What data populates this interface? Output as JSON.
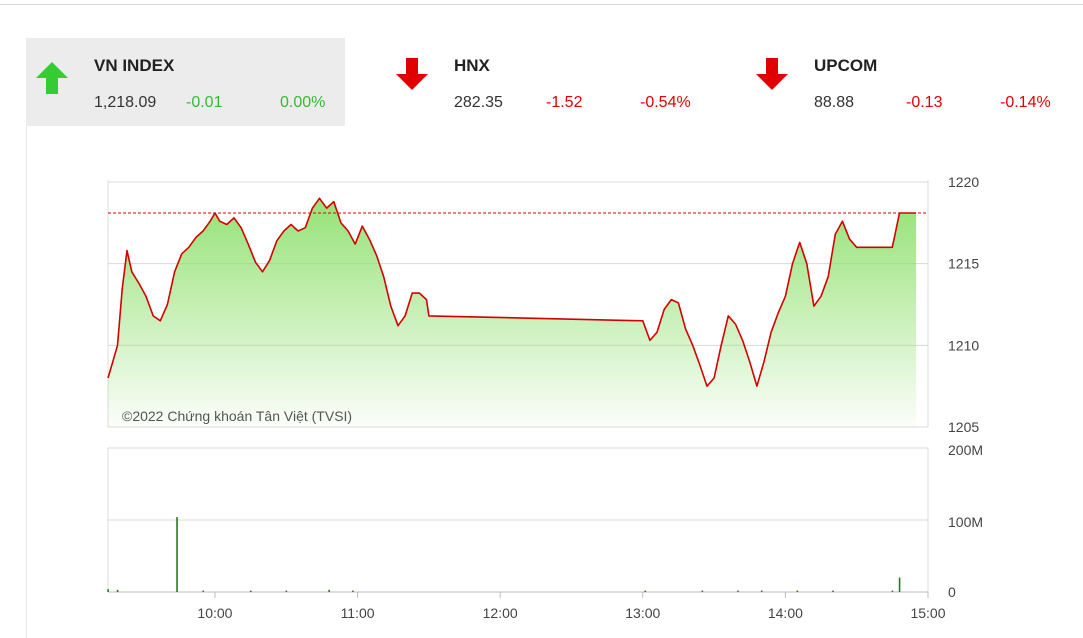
{
  "tickers": [
    {
      "name": "VN INDEX",
      "value": "1,218.09",
      "change": "-0.01",
      "pct": "0.00%",
      "direction": "up",
      "active": true
    },
    {
      "name": "HNX",
      "value": "282.35",
      "change": "-1.52",
      "pct": "-0.54%",
      "direction": "down",
      "active": false
    },
    {
      "name": "UPCOM",
      "value": "88.88",
      "change": "-0.13",
      "pct": "-0.14%",
      "direction": "down",
      "active": false
    }
  ],
  "colors": {
    "up": "#33cc33",
    "down": "#e00000",
    "line": "#d40000",
    "fill": "#8fe06e",
    "grid": "#d8d8d8"
  },
  "copyright": "©2022 Chứng khoán Tân Việt (TVSI)",
  "chart_data": [
    {
      "type": "area",
      "name": "price",
      "y_ticks": [
        "1220",
        "1215",
        "1210",
        "1205"
      ],
      "ylim": [
        1205,
        1220
      ],
      "reference": 1218.1,
      "x_ticks": [
        "10:00",
        "11:00",
        "12:00",
        "13:00",
        "14:00",
        "15:00"
      ],
      "xlim": [
        "09:15",
        "15:00"
      ],
      "points": [
        [
          "09:15",
          1208.0
        ],
        [
          "09:17",
          1209.0
        ],
        [
          "09:19",
          1210.0
        ],
        [
          "09:21",
          1213.5
        ],
        [
          "09:23",
          1215.8
        ],
        [
          "09:25",
          1214.5
        ],
        [
          "09:28",
          1213.8
        ],
        [
          "09:31",
          1213.0
        ],
        [
          "09:34",
          1211.8
        ],
        [
          "09:37",
          1211.5
        ],
        [
          "09:40",
          1212.5
        ],
        [
          "09:43",
          1214.5
        ],
        [
          "09:46",
          1215.6
        ],
        [
          "09:49",
          1216.0
        ],
        [
          "09:52",
          1216.6
        ],
        [
          "09:55",
          1217.0
        ],
        [
          "09:58",
          1217.6
        ],
        [
          "10:00",
          1218.1
        ],
        [
          "10:02",
          1217.6
        ],
        [
          "10:05",
          1217.4
        ],
        [
          "10:08",
          1217.8
        ],
        [
          "10:11",
          1217.2
        ],
        [
          "10:14",
          1216.2
        ],
        [
          "10:17",
          1215.1
        ],
        [
          "10:20",
          1214.5
        ],
        [
          "10:23",
          1215.2
        ],
        [
          "10:26",
          1216.4
        ],
        [
          "10:29",
          1217.0
        ],
        [
          "10:32",
          1217.4
        ],
        [
          "10:35",
          1217.0
        ],
        [
          "10:38",
          1217.2
        ],
        [
          "10:41",
          1218.4
        ],
        [
          "10:44",
          1219.0
        ],
        [
          "10:47",
          1218.4
        ],
        [
          "10:50",
          1218.8
        ],
        [
          "10:53",
          1217.5
        ],
        [
          "10:56",
          1217.0
        ],
        [
          "10:59",
          1216.2
        ],
        [
          "11:02",
          1217.3
        ],
        [
          "11:05",
          1216.5
        ],
        [
          "11:08",
          1215.5
        ],
        [
          "11:11",
          1214.2
        ],
        [
          "11:14",
          1212.4
        ],
        [
          "11:17",
          1211.2
        ],
        [
          "11:20",
          1211.8
        ],
        [
          "11:23",
          1213.2
        ],
        [
          "11:26",
          1213.2
        ],
        [
          "11:29",
          1212.8
        ],
        [
          "11:30",
          1211.8
        ],
        [
          "13:00",
          1211.5
        ],
        [
          "13:03",
          1210.3
        ],
        [
          "13:06",
          1210.8
        ],
        [
          "13:09",
          1212.2
        ],
        [
          "13:12",
          1212.8
        ],
        [
          "13:15",
          1212.6
        ],
        [
          "13:18",
          1211.0
        ],
        [
          "13:21",
          1210.0
        ],
        [
          "13:24",
          1208.8
        ],
        [
          "13:27",
          1207.5
        ],
        [
          "13:30",
          1208.0
        ],
        [
          "13:33",
          1210.0
        ],
        [
          "13:36",
          1211.8
        ],
        [
          "13:39",
          1211.3
        ],
        [
          "13:42",
          1210.3
        ],
        [
          "13:45",
          1209.0
        ],
        [
          "13:48",
          1207.5
        ],
        [
          "13:51",
          1209.0
        ],
        [
          "13:54",
          1210.8
        ],
        [
          "13:57",
          1212.0
        ],
        [
          "14:00",
          1213.0
        ],
        [
          "14:03",
          1215.0
        ],
        [
          "14:06",
          1216.3
        ],
        [
          "14:09",
          1215.0
        ],
        [
          "14:12",
          1212.4
        ],
        [
          "14:15",
          1213.0
        ],
        [
          "14:18",
          1214.2
        ],
        [
          "14:21",
          1216.8
        ],
        [
          "14:24",
          1217.6
        ],
        [
          "14:27",
          1216.5
        ],
        [
          "14:30",
          1216.0
        ],
        [
          "14:45",
          1216.0
        ],
        [
          "14:48",
          1218.1
        ],
        [
          "14:55",
          1218.1
        ]
      ]
    },
    {
      "type": "bar",
      "name": "volume",
      "y_ticks": [
        "200M",
        "100M",
        "0"
      ],
      "ylim": [
        0,
        200
      ],
      "x_ticks": [
        "10:00",
        "11:00",
        "12:00",
        "13:00",
        "14:00",
        "15:00"
      ],
      "bars": [
        [
          "09:15",
          4
        ],
        [
          "09:19",
          3
        ],
        [
          "09:44",
          104
        ],
        [
          "09:55",
          2
        ],
        [
          "10:15",
          2
        ],
        [
          "10:30",
          2
        ],
        [
          "10:48",
          3
        ],
        [
          "10:58",
          2
        ],
        [
          "13:01",
          2
        ],
        [
          "13:25",
          2
        ],
        [
          "13:40",
          2
        ],
        [
          "13:50",
          2
        ],
        [
          "14:05",
          2
        ],
        [
          "14:20",
          2
        ],
        [
          "14:45",
          2
        ],
        [
          "14:48",
          20
        ]
      ]
    }
  ]
}
